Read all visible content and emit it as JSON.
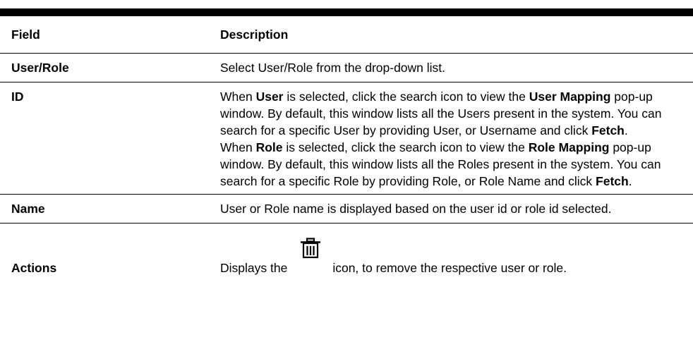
{
  "table": {
    "headers": {
      "field": "Field",
      "description": "Description"
    },
    "rows": {
      "user_role": {
        "field": "User/Role",
        "description": "Select User/Role from the drop-down list."
      },
      "id": {
        "field": "ID",
        "description": {
          "p1": {
            "t1": "When ",
            "b1": "User",
            "t2": " is selected, click the search icon to view the ",
            "b2": "User Mapping",
            "t3": " pop-up window. By default, this window lists all the Users present in the system. You can search for a specific User by providing User, or Username and click ",
            "b3": "Fetch",
            "t4": "."
          },
          "p2": {
            "t1": "When ",
            "b1": "Role",
            "t2": " is selected, click the search icon to view the ",
            "b2": "Role Mapping",
            "t3": " pop-up window. By default, this window lists all the Roles present in the system. You can search for a specific Role by providing Role, or Role Name and click ",
            "b3": "Fetch",
            "t4": "."
          }
        }
      },
      "name": {
        "field": "Name",
        "description": "User or Role name is displayed based on the user id or role id selected."
      },
      "actions": {
        "field": "Actions",
        "description_before": "Displays the",
        "icon": "trash-icon",
        "description_after": "icon, to remove the respective user or role."
      }
    }
  }
}
